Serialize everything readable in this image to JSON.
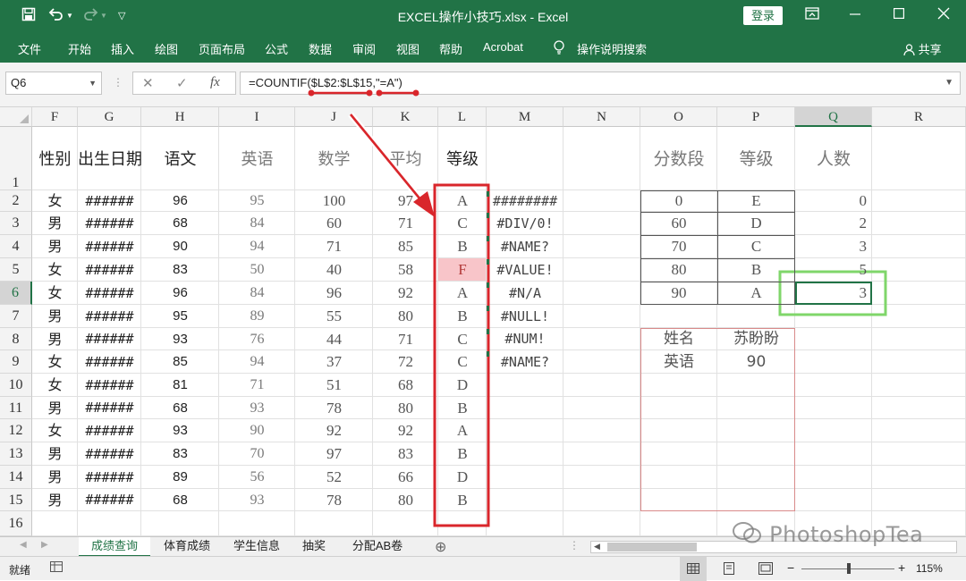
{
  "window": {
    "title": "EXCEL操作小技巧.xlsx  -  Excel",
    "login_label": "登录",
    "quick_access": [
      "save-icon",
      "undo-icon",
      "redo-icon",
      "customize-icon"
    ],
    "controls": [
      "ribbon-display-icon",
      "minimize-icon",
      "maximize-icon",
      "close-icon"
    ]
  },
  "ribbon": {
    "tabs": [
      "文件",
      "开始",
      "插入",
      "绘图",
      "页面布局",
      "公式",
      "数据",
      "审阅",
      "视图",
      "帮助",
      "Acrobat",
      "操作说明搜索"
    ],
    "share_label": "共享"
  },
  "formula_bar": {
    "name_box": "Q6",
    "formula": "=COUNTIF($L$2:$L$15,\"=A\")"
  },
  "sheet": {
    "columns": [
      "F",
      "G",
      "H",
      "I",
      "J",
      "K",
      "L",
      "M",
      "N",
      "O",
      "P",
      "Q",
      "R"
    ],
    "selected_column": "Q",
    "selected_row": "6",
    "rows": [
      "1",
      "2",
      "3",
      "4",
      "5",
      "6",
      "7",
      "8",
      "9",
      "10",
      "11",
      "12",
      "13",
      "14",
      "15",
      "16"
    ],
    "header_row": {
      "F": "性别",
      "G": "出生日期",
      "H": "语文",
      "I": "英语",
      "J": "数学",
      "K": "平均",
      "L": "等级"
    },
    "data_rows": [
      {
        "F": "女",
        "G": "######",
        "H": "96",
        "I": "95",
        "J": "100",
        "K": "97",
        "L": "A",
        "M": "########"
      },
      {
        "F": "男",
        "G": "######",
        "H": "68",
        "I": "84",
        "J": "60",
        "K": "71",
        "L": "C",
        "M": "#DIV/0!"
      },
      {
        "F": "男",
        "G": "######",
        "H": "90",
        "I": "94",
        "J": "71",
        "K": "85",
        "L": "B",
        "M": "#NAME?"
      },
      {
        "F": "女",
        "G": "######",
        "H": "83",
        "I": "50",
        "J": "40",
        "K": "58",
        "L": "F",
        "M": "#VALUE!"
      },
      {
        "F": "女",
        "G": "######",
        "H": "96",
        "I": "84",
        "J": "96",
        "K": "92",
        "L": "A",
        "M": "#N/A"
      },
      {
        "F": "男",
        "G": "######",
        "H": "95",
        "I": "89",
        "J": "55",
        "K": "80",
        "L": "B",
        "M": "#NULL!"
      },
      {
        "F": "男",
        "G": "######",
        "H": "93",
        "I": "76",
        "J": "44",
        "K": "71",
        "L": "C",
        "M": "#NUM!"
      },
      {
        "F": "女",
        "G": "######",
        "H": "85",
        "I": "94",
        "J": "37",
        "K": "72",
        "L": "C",
        "M": "#NAME?"
      },
      {
        "F": "女",
        "G": "######",
        "H": "81",
        "I": "71",
        "J": "51",
        "K": "68",
        "L": "D",
        "M": ""
      },
      {
        "F": "男",
        "G": "######",
        "H": "68",
        "I": "93",
        "J": "78",
        "K": "80",
        "L": "B",
        "M": ""
      },
      {
        "F": "女",
        "G": "######",
        "H": "93",
        "I": "90",
        "J": "92",
        "K": "92",
        "L": "A",
        "M": ""
      },
      {
        "F": "男",
        "G": "######",
        "H": "83",
        "I": "70",
        "J": "97",
        "K": "83",
        "L": "B",
        "M": ""
      },
      {
        "F": "男",
        "G": "######",
        "H": "89",
        "I": "56",
        "J": "52",
        "K": "66",
        "L": "D",
        "M": ""
      },
      {
        "F": "男",
        "G": "######",
        "H": "68",
        "I": "93",
        "J": "78",
        "K": "80",
        "L": "B",
        "M": ""
      }
    ],
    "grade_table": {
      "headers": {
        "O": "分数段",
        "P": "等级",
        "Q": "人数"
      },
      "rows": [
        {
          "O": "0",
          "P": "E",
          "Q": "0"
        },
        {
          "O": "60",
          "P": "D",
          "Q": "2"
        },
        {
          "O": "70",
          "P": "C",
          "Q": "3"
        },
        {
          "O": "80",
          "P": "B",
          "Q": "5"
        },
        {
          "O": "90",
          "P": "A",
          "Q": "3"
        }
      ]
    },
    "lookup_table": [
      {
        "O": "姓名",
        "P": "苏盼盼"
      },
      {
        "O": "英语",
        "P": "90"
      }
    ]
  },
  "sheet_tabs": {
    "tabs": [
      "成绩查询",
      "体育成绩",
      "学生信息",
      "抽奖",
      "分配AB卷"
    ],
    "active": "成绩查询"
  },
  "status_bar": {
    "status": "就绪",
    "zoom": "115%"
  },
  "watermark": "PhotoshopTea",
  "colors": {
    "excel_green": "#217346",
    "highlight_red": "#d9262b",
    "highlight_green": "#7fd66a",
    "fail_cell_fill": "#f8c5c9"
  }
}
